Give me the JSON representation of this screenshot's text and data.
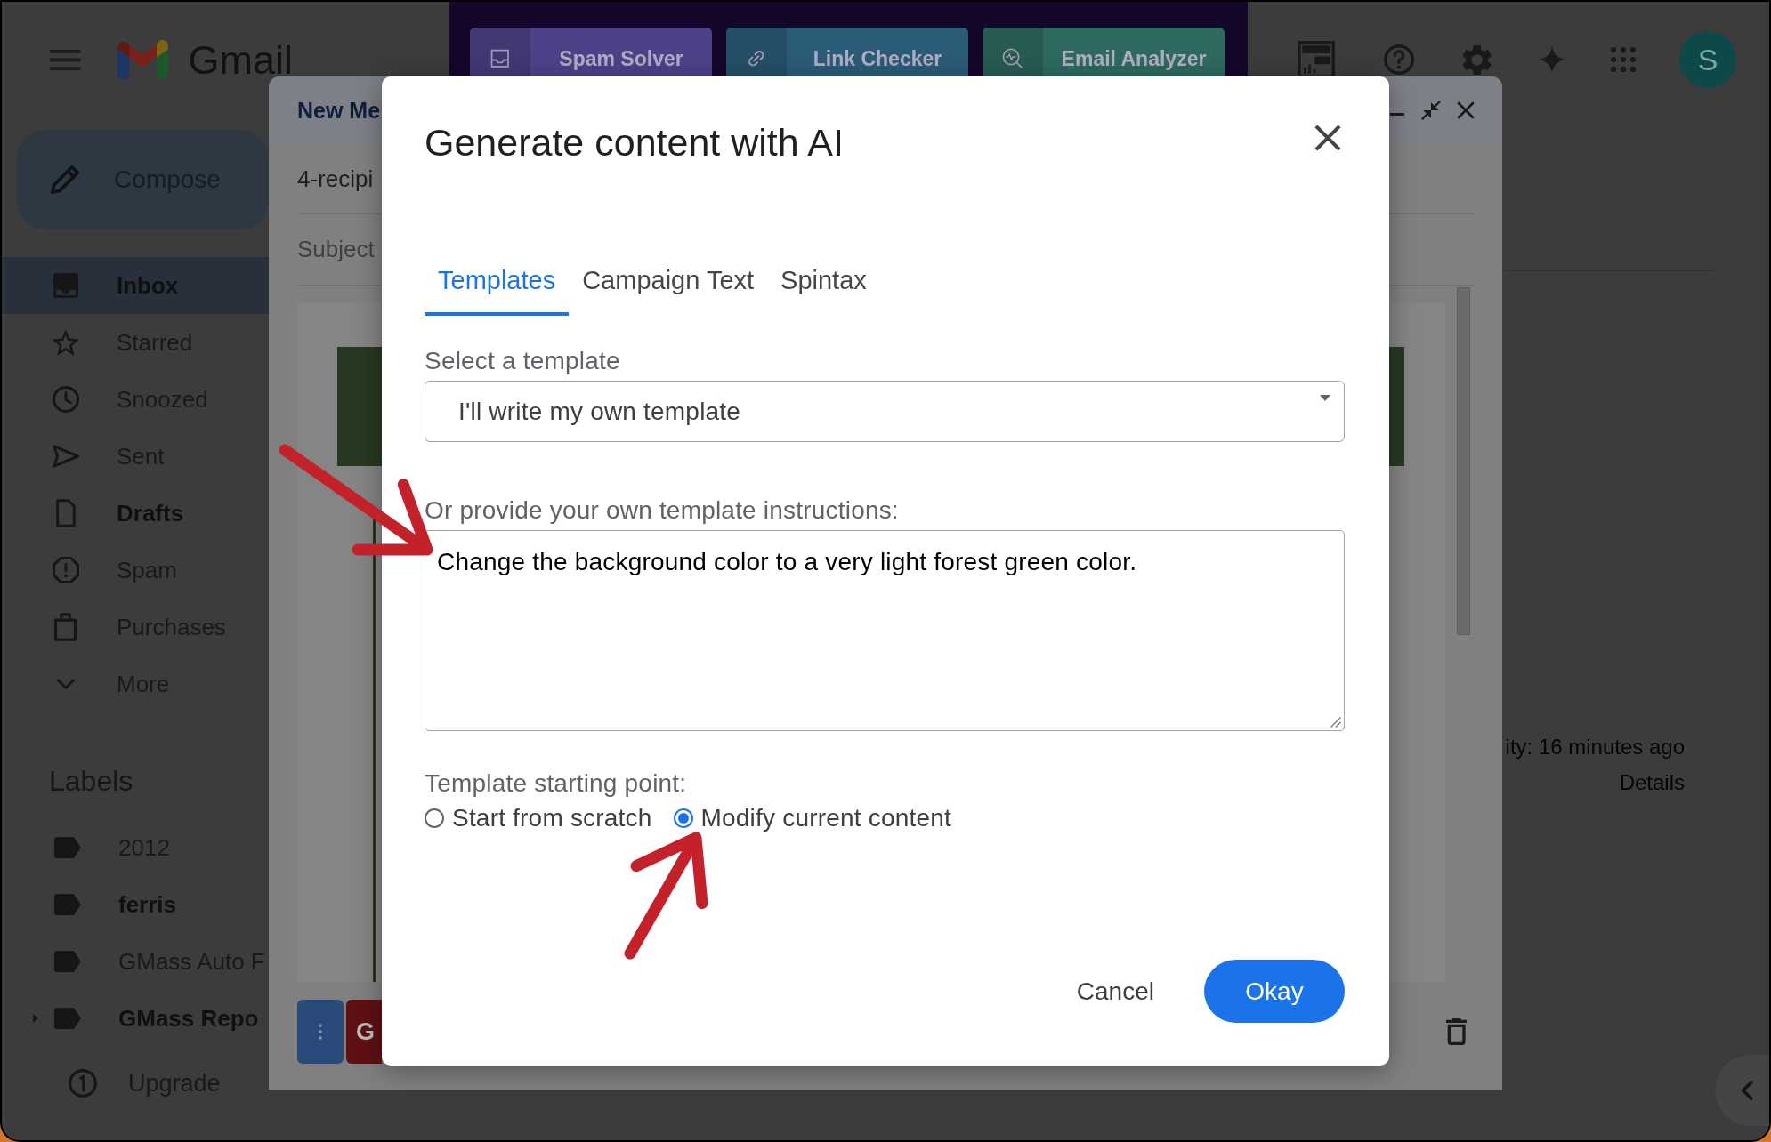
{
  "gmail_header": {
    "app_name": "Gmail"
  },
  "extension_toolbar": {
    "buttons": [
      {
        "label": "Spam Solver",
        "color": "#4e4188"
      },
      {
        "label": "Link Checker",
        "color": "#2b5c77"
      },
      {
        "label": "Email Analyzer",
        "color": "#2e6a5f"
      }
    ]
  },
  "account": {
    "initial": "S"
  },
  "sidebar": {
    "compose_label": "Compose",
    "items": [
      {
        "label": "Inbox",
        "selected": true,
        "unread": true
      },
      {
        "label": "Starred",
        "selected": false,
        "unread": false
      },
      {
        "label": "Snoozed",
        "selected": false,
        "unread": false
      },
      {
        "label": "Sent",
        "selected": false,
        "unread": false
      },
      {
        "label": "Drafts",
        "selected": false,
        "unread": true
      },
      {
        "label": "Spam",
        "selected": false,
        "unread": false
      },
      {
        "label": "Purchases",
        "selected": false,
        "unread": false
      },
      {
        "label": "More",
        "selected": false,
        "unread": false
      }
    ]
  },
  "labels": {
    "heading": "Labels",
    "items": [
      {
        "label": "2012",
        "unread": false,
        "has_children": false
      },
      {
        "label": "ferris",
        "unread": true,
        "has_children": false
      },
      {
        "label": "GMass Auto F",
        "unread": false,
        "has_children": false
      },
      {
        "label": "GMass Repo",
        "unread": true,
        "has_children": true
      }
    ]
  },
  "upgrade": {
    "label": "Upgrade"
  },
  "activity": {
    "text": "ity: 16 minutes ago",
    "link": "Details"
  },
  "compose_window": {
    "title": "New Me",
    "recipients": "4-recipi",
    "subject": {
      "placeholder": "Subject"
    },
    "send_button": "G"
  },
  "dialog": {
    "title": "Generate content with AI",
    "tabs": [
      {
        "label": "Templates",
        "selected": true
      },
      {
        "label": "Campaign Text",
        "selected": false
      },
      {
        "label": "Spintax",
        "selected": false
      }
    ],
    "template_select": {
      "label": "Select a template",
      "value": "I'll write my own template"
    },
    "instructions": {
      "label": "Or provide your own template instructions:",
      "value": "Change the background color to a very light forest green color."
    },
    "starting_point": {
      "label": "Template starting point:",
      "options": [
        {
          "label": "Start from scratch",
          "selected": false
        },
        {
          "label": "Modify current content",
          "selected": true
        }
      ]
    },
    "buttons": [
      {
        "label": "Cancel",
        "kind": "text"
      },
      {
        "label": "Okay",
        "kind": "primary"
      }
    ]
  }
}
